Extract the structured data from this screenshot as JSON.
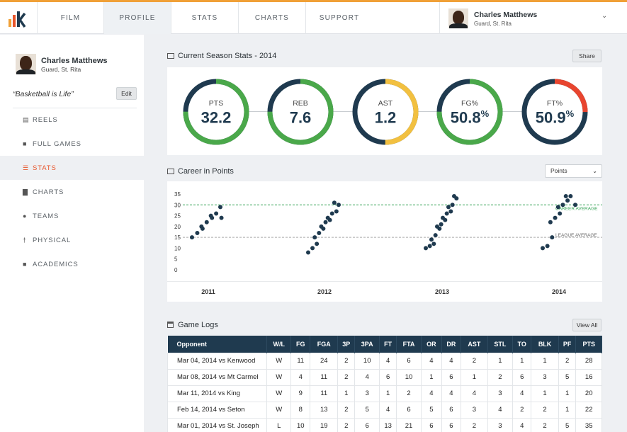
{
  "nav": {
    "items": [
      {
        "label": "FILM"
      },
      {
        "label": "PROFILE"
      },
      {
        "label": "STATS"
      },
      {
        "label": "CHARTS"
      },
      {
        "label": "SUPPORT"
      }
    ],
    "active": "PROFILE"
  },
  "user": {
    "name": "Charles Matthews",
    "role": "Guard, St. Rita"
  },
  "profile": {
    "name": "Charles Matthews",
    "role": "Guard, St. Rita",
    "motto": "“Basketball is Life”",
    "edit_label": "Edit"
  },
  "sidebar": {
    "items": [
      {
        "label": "REELS",
        "icon": "film-icon"
      },
      {
        "label": "FULL GAMES",
        "icon": "video-icon"
      },
      {
        "label": "STATS",
        "icon": "table-icon"
      },
      {
        "label": "CHARTS",
        "icon": "bar-chart-icon"
      },
      {
        "label": "TEAMS",
        "icon": "users-icon"
      },
      {
        "label": "PHYSICAL",
        "icon": "person-icon"
      },
      {
        "label": "ACADEMICS",
        "icon": "book-icon"
      }
    ],
    "active": "STATS"
  },
  "season": {
    "title": "Current Season Stats - 2014",
    "share_label": "Share",
    "stats": [
      {
        "label": "PTS",
        "value": "32.2",
        "unit": "",
        "fill": 0.75,
        "color": "#4aa84a"
      },
      {
        "label": "REB",
        "value": "7.6",
        "unit": "",
        "fill": 0.75,
        "color": "#4aa84a"
      },
      {
        "label": "AST",
        "value": "1.2",
        "unit": "",
        "fill": 0.5,
        "color": "#f2c040"
      },
      {
        "label": "FG%",
        "value": "50.8",
        "unit": "%",
        "fill": 0.75,
        "color": "#4aa84a"
      },
      {
        "label": "FT%",
        "value": "50.9",
        "unit": "%",
        "fill": 0.25,
        "color": "#e8452f"
      }
    ]
  },
  "colors": {
    "ring_track": "#1f3a4f",
    "dark": "#1f3a4f",
    "accent": "#e8552b",
    "green_line": "#3aa65a",
    "gray_line": "#aaaaaa"
  },
  "career": {
    "title": "Career in Points",
    "select_value": "Points"
  },
  "chart_data": {
    "type": "scatter",
    "title": "Career in Points",
    "ylim": [
      0,
      35
    ],
    "yticks": [
      0,
      5,
      10,
      15,
      20,
      25,
      30,
      35
    ],
    "groups": [
      "2011",
      "2012",
      "2013",
      "2014"
    ],
    "reference_lines": [
      {
        "label": "CAREER AVERAGE",
        "y": 30
      },
      {
        "label": "LEAGUE AVERAGE",
        "y": 15
      }
    ],
    "series": [
      {
        "group": "2011",
        "points": [
          15,
          17,
          19,
          20,
          22,
          24,
          25,
          26,
          24,
          29
        ]
      },
      {
        "group": "2012",
        "points": [
          8,
          10,
          12,
          15,
          17,
          19,
          20,
          22,
          23,
          24,
          26,
          27,
          31,
          30
        ]
      },
      {
        "group": "2013",
        "points": [
          10,
          11,
          12,
          14,
          16,
          19,
          20,
          21,
          23,
          24,
          26,
          27,
          29,
          30,
          33,
          34
        ]
      },
      {
        "group": "2014",
        "points": [
          10,
          11,
          15,
          22,
          24,
          26,
          29,
          30,
          32,
          34,
          34,
          30
        ]
      }
    ]
  },
  "gamelogs": {
    "title": "Game Logs",
    "view_all_label": "View All",
    "columns": [
      "Opponent",
      "W/L",
      "FG",
      "FGA",
      "3P",
      "3PA",
      "FT",
      "FTA",
      "OR",
      "DR",
      "AST",
      "STL",
      "TO",
      "BLK",
      "PF",
      "PTS"
    ],
    "rows": [
      [
        "Mar 04, 2014 vs Kenwood",
        "W",
        "11",
        "24",
        "2",
        "10",
        "4",
        "6",
        "4",
        "4",
        "2",
        "1",
        "1",
        "1",
        "2",
        "28"
      ],
      [
        "Mar 08, 2014 vs Mt Carmel",
        "W",
        "4",
        "11",
        "2",
        "4",
        "6",
        "10",
        "1",
        "6",
        "1",
        "2",
        "6",
        "3",
        "5",
        "16"
      ],
      [
        "Mar 11, 2014 vs King",
        "W",
        "9",
        "11",
        "1",
        "3",
        "1",
        "2",
        "4",
        "4",
        "4",
        "3",
        "4",
        "1",
        "1",
        "20"
      ],
      [
        "Feb 14, 2014 vs Seton",
        "W",
        "8",
        "13",
        "2",
        "5",
        "4",
        "6",
        "5",
        "6",
        "3",
        "4",
        "2",
        "2",
        "1",
        "22"
      ],
      [
        "Mar 01, 2014 vs St. Joseph",
        "L",
        "10",
        "19",
        "2",
        "6",
        "13",
        "21",
        "6",
        "6",
        "2",
        "3",
        "4",
        "2",
        "5",
        "35"
      ]
    ]
  }
}
